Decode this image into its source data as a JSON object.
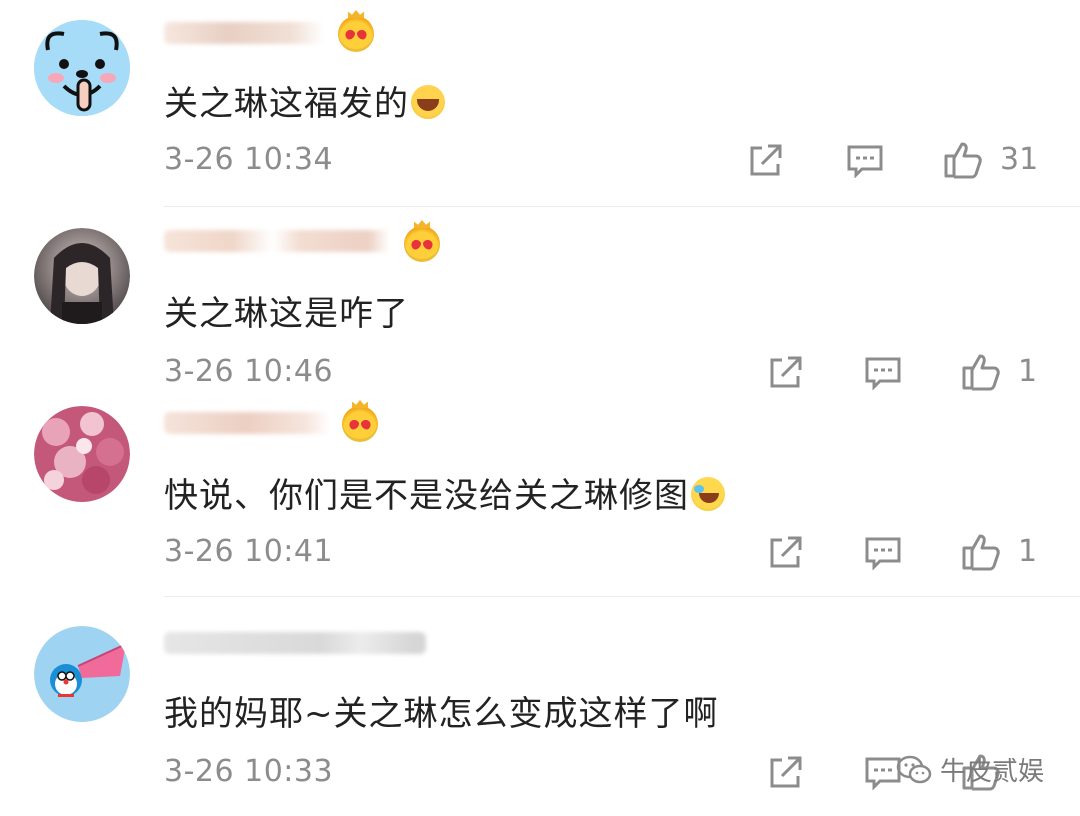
{
  "comments": [
    {
      "text": "关之琳这福发的",
      "emoji": "laugh-emoji",
      "time": "3-26 10:34",
      "likes": "31",
      "avatar": "blue-dog-avatar"
    },
    {
      "text": "关之琳这是咋了",
      "emoji": "",
      "time": "3-26 10:46",
      "likes": "1",
      "avatar": "girl-photo-avatar"
    },
    {
      "text": "快说、你们是不是没给关之琳修图",
      "emoji": "lol-emoji",
      "time": "3-26 10:41",
      "likes": "1",
      "avatar": "pink-flowers-avatar"
    },
    {
      "text": "我的妈耶~关之琳怎么变成这样了啊",
      "emoji": "",
      "time": "3-26 10:33",
      "likes": "",
      "avatar": "doraemon-avatar"
    }
  ],
  "watermark": {
    "text": "牛皮贰娱",
    "icon": "wechat-icon"
  },
  "colors": {
    "text": "#222222",
    "meta": "#8c8c8c",
    "badge": "#ffcf3a"
  }
}
